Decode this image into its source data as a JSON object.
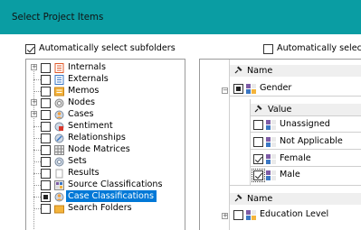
{
  "window": {
    "title": "Select Project Items"
  },
  "options": {
    "auto_subfolders_label": "Automatically select subfolders",
    "auto_subfolders_checked": true,
    "auto_select_label": "Automatically select",
    "auto_select_checked": false
  },
  "tree": {
    "items": [
      {
        "label": "Internals",
        "icon": "internals-folder-icon",
        "expandable": true,
        "checked": false
      },
      {
        "label": "Externals",
        "icon": "externals-folder-icon",
        "expandable": false,
        "checked": false
      },
      {
        "label": "Memos",
        "icon": "memos-folder-icon",
        "expandable": false,
        "checked": false
      },
      {
        "label": "Nodes",
        "icon": "nodes-icon",
        "expandable": true,
        "checked": false
      },
      {
        "label": "Cases",
        "icon": "cases-icon",
        "expandable": true,
        "checked": false
      },
      {
        "label": "Sentiment",
        "icon": "sentiment-icon",
        "expandable": false,
        "checked": false
      },
      {
        "label": "Relationships",
        "icon": "relationships-icon",
        "expandable": false,
        "checked": false
      },
      {
        "label": "Node Matrices",
        "icon": "node-matrices-icon",
        "expandable": false,
        "checked": false
      },
      {
        "label": "Sets",
        "icon": "sets-icon",
        "expandable": false,
        "checked": false
      },
      {
        "label": "Results",
        "icon": "results-icon",
        "expandable": false,
        "checked": false
      },
      {
        "label": "Source Classifications",
        "icon": "source-classifications-icon",
        "expandable": false,
        "checked": false
      },
      {
        "label": "Case Classifications",
        "icon": "case-classifications-icon",
        "expandable": false,
        "checked": "indeterminate",
        "selected": true
      },
      {
        "label": "Search Folders",
        "icon": "search-folders-icon",
        "expandable": false,
        "checked": false
      }
    ]
  },
  "attributes": {
    "name_header": "Name",
    "value_header": "Value",
    "groups": [
      {
        "name": "Gender",
        "checked": "indeterminate",
        "expanded": true,
        "values": [
          {
            "label": "Unassigned",
            "checked": false
          },
          {
            "label": "Not Applicable",
            "checked": false
          },
          {
            "label": "Female",
            "checked": true
          },
          {
            "label": "Male",
            "checked": true,
            "focused": true
          }
        ]
      },
      {
        "name": "Education Level",
        "checked": false,
        "expanded": false
      }
    ]
  },
  "colors": {
    "titlebar": "#0a9da3",
    "selection": "#0078d7"
  }
}
